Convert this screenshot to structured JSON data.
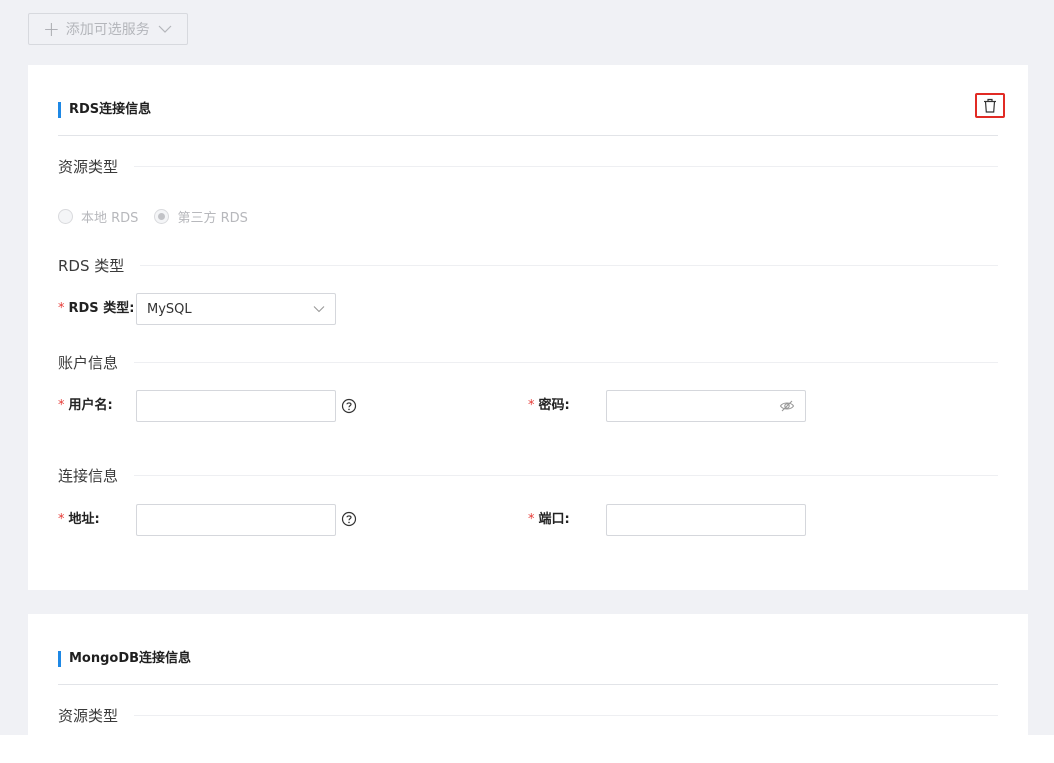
{
  "toolbar": {
    "add_service_label": "添加可选服务"
  },
  "rds_card": {
    "title": "RDS连接信息",
    "resource_type_section": "资源类型",
    "radio_local": "本地 RDS",
    "radio_third_party": "第三方 RDS",
    "selected_radio": "第三方 RDS",
    "rds_type_section": "RDS 类型",
    "rds_type_label": "RDS 类型:",
    "rds_type_value": "MySQL",
    "account_section": "账户信息",
    "username_label": "用户名:",
    "username_value": "",
    "password_label": "密码:",
    "password_value": "",
    "connection_section": "连接信息",
    "address_label": "地址:",
    "address_value": "",
    "port_label": "端口:",
    "port_value": "",
    "required_mark": "*"
  },
  "mongo_card": {
    "title": "MongoDB连接信息",
    "resource_type_section": "资源类型"
  },
  "colors": {
    "accent": "#1e88e5",
    "required": "#e53935",
    "highlight_border": "#e12b24",
    "page_bg": "#f0f1f5"
  },
  "icons": [
    "plus-icon",
    "chevron-down-icon",
    "trash-icon",
    "help-circle-icon",
    "eye-off-icon"
  ]
}
